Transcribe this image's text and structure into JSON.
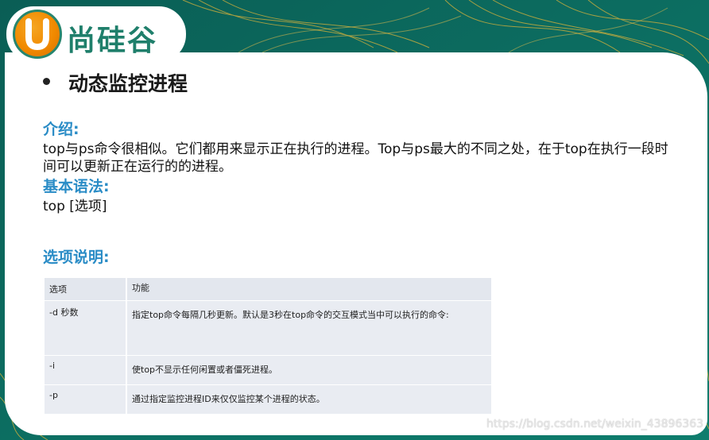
{
  "brand": {
    "logo_text": "尚硅谷",
    "logo_mark": "U"
  },
  "heading": "动态监控进程",
  "intro": {
    "title": "介绍:",
    "text": "top与ps命令很相似。它们都用来显示正在执行的进程。Top与ps最大的不同之处，在于top在执行一段时间可以更新正在运行的的进程。"
  },
  "syntax": {
    "title": "基本语法:",
    "text": "top [选项]"
  },
  "options": {
    "title": "选项说明:",
    "header": [
      "选项",
      "功能"
    ],
    "rows": [
      {
        "option": "-d 秒数",
        "desc": "指定top命令每隔几秒更新。默认是3秒在top命令的交互模式当中可以执行的命令:"
      },
      {
        "option": "-i",
        "desc": "使top不显示任何闲置或者僵死进程。"
      },
      {
        "option": "-p",
        "desc": "通过指定监控进程ID来仅仅监控某个进程的状态。"
      }
    ]
  },
  "watermark": "https://blog.csdn.net/weixin_43896363",
  "colors": {
    "accent": "#2a8cc6",
    "brand_green": "#1f7f6b",
    "brand_orange": "#f18a00",
    "background": "#0b6f63"
  }
}
